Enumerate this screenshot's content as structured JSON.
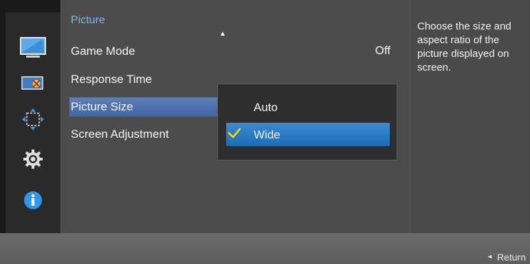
{
  "sidebar": {
    "icons": [
      {
        "name": "picture-icon"
      },
      {
        "name": "color-icon"
      },
      {
        "name": "position-icon"
      },
      {
        "name": "settings-icon"
      },
      {
        "name": "information-icon"
      }
    ]
  },
  "panel": {
    "title": "Picture",
    "scroll_indicator": "▲",
    "items": [
      {
        "label": "Game Mode",
        "value": "Off"
      },
      {
        "label": "Response Time"
      },
      {
        "label": "Picture Size"
      },
      {
        "label": "Screen Adjustment"
      }
    ]
  },
  "popup": {
    "options": [
      {
        "label": "Auto",
        "selected": false
      },
      {
        "label": "Wide",
        "selected": true
      }
    ]
  },
  "info": {
    "text": "Choose the size and aspect ratio of the picture displayed on screen."
  },
  "footer": {
    "return_label": "Return",
    "return_arrow": "◄"
  },
  "colors": {
    "accent_title": "#7ab8ef",
    "selection_blue": "#1a6db8",
    "check_yellow": "#f2e000"
  }
}
